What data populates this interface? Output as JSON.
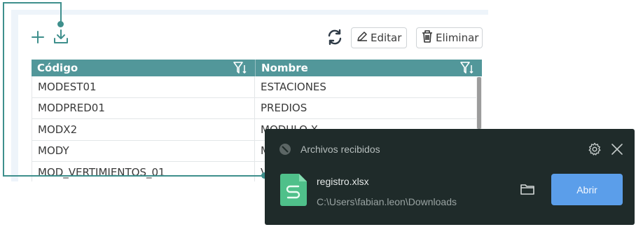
{
  "toolbar": {
    "add_icon": "plus-icon",
    "download_icon": "download-icon",
    "refresh_icon": "refresh-icon",
    "edit_label": "Editar",
    "edit_icon": "pencil-icon",
    "delete_label": "Eliminar",
    "delete_icon": "trash-icon"
  },
  "table": {
    "columns": [
      {
        "label": "Código",
        "filter_icon": "filter-sort-icon"
      },
      {
        "label": "Nombre",
        "filter_icon": "filter-sort-icon"
      }
    ],
    "rows": [
      {
        "code": "MODEST01",
        "name": "ESTACIONES"
      },
      {
        "code": "MODPRED01",
        "name": "PREDIOS"
      },
      {
        "code": "MODX2",
        "name": "MODULO X"
      },
      {
        "code": "MODY",
        "name": "M"
      },
      {
        "code": "MOD_VERTIMIENTOS_01",
        "name": "V"
      }
    ]
  },
  "download_popup": {
    "title": "Archivos recibidos",
    "status_icon": "blocked-circle-icon",
    "settings_icon": "gear-icon",
    "close_icon": "close-icon",
    "file": {
      "name": "registro.xlsx",
      "path": "C:\\Users\\fabian.leon\\Downloads",
      "icon": "spreadsheet-file-icon"
    },
    "folder_icon": "folder-icon",
    "open_label": "Abrir"
  },
  "colors": {
    "accent_teal": "#3e8f8c",
    "header_teal": "#52979a",
    "popup_bg": "#1f2b2a",
    "open_button": "#5b9eea",
    "file_icon_green": "#4fc08a"
  }
}
